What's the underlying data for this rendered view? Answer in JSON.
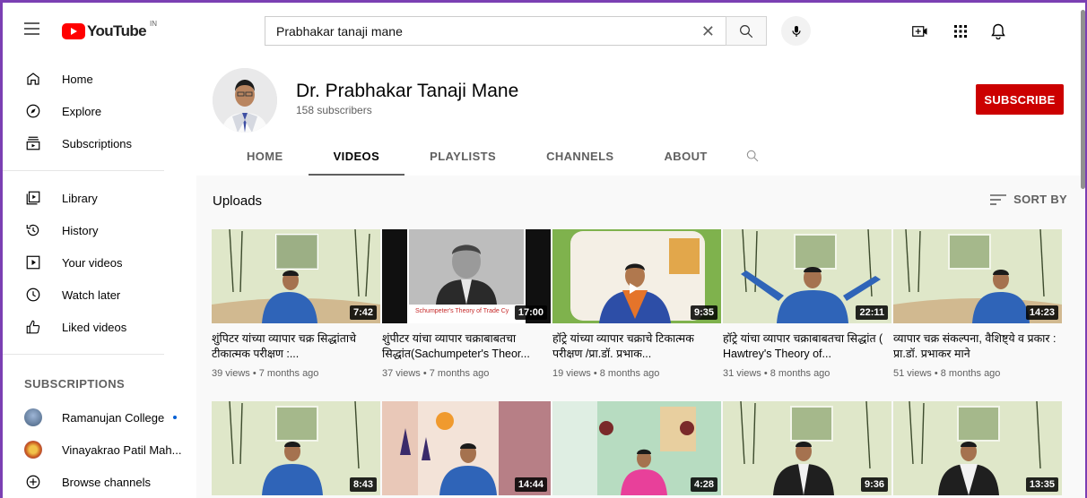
{
  "topbar": {
    "logo_text": "YouTube",
    "country_code": "IN",
    "search_value": "Prabhakar tanaji mane",
    "icons": [
      "menu-icon",
      "search-icon",
      "mic-icon",
      "create-icon",
      "apps-icon",
      "notifications-icon"
    ]
  },
  "sidebar": {
    "items": [
      {
        "label": "Home",
        "icon": "home-icon"
      },
      {
        "label": "Explore",
        "icon": "compass-icon"
      },
      {
        "label": "Subscriptions",
        "icon": "subscriptions-icon"
      },
      {
        "label": "Library",
        "icon": "library-icon"
      },
      {
        "label": "History",
        "icon": "history-icon"
      },
      {
        "label": "Your videos",
        "icon": "your-videos-icon"
      },
      {
        "label": "Watch later",
        "icon": "clock-icon"
      },
      {
        "label": "Liked videos",
        "icon": "thumbs-up-icon"
      }
    ],
    "subscriptions_heading": "SUBSCRIPTIONS",
    "subscriptions": [
      {
        "label": "Ramanujan College"
      },
      {
        "label": "Vinayakrao Patil Mah..."
      }
    ],
    "browse_label": "Browse channels"
  },
  "channel": {
    "name": "Dr. Prabhakar Tanaji Mane",
    "subscribers": "158 subscribers",
    "subscribe_label": "SUBSCRIBE",
    "tabs": [
      "HOME",
      "VIDEOS",
      "PLAYLISTS",
      "CHANNELS",
      "ABOUT"
    ],
    "active_tab": "VIDEOS"
  },
  "uploads": {
    "heading": "Uploads",
    "sort_label": "SORT BY",
    "videos": [
      {
        "title": "शुंपिटर यांच्या व्यापार चक्र सिद्धांताचे टीकात्मक परीक्षण :...",
        "meta": "39 views • 7 months ago",
        "duration": "7:42"
      },
      {
        "title": "शुंपीटर यांचा व्यापार चक्राबाबतचा सिद्धांत(Sachumpeter's Theor...",
        "meta": "37 views • 7 months ago",
        "duration": "17:00",
        "thumb_caption": "Schumpeter's Theory of Trade Cy"
      },
      {
        "title": "हॉट्रे यांच्या व्यापार चक्राचे टिकात्मक परीक्षण /प्रा.डॉ. प्रभाक...",
        "meta": "19 views • 8 months ago",
        "duration": "9:35"
      },
      {
        "title": "हॉट्रे यांचा व्यापार चक्राबाबतचा सिद्धांत ( Hawtrey's Theory of...",
        "meta": "31 views • 8 months ago",
        "duration": "22:11"
      },
      {
        "title": "व्यापार चक्र संकल्पना, वैशिष्ट्ये व प्रकार : प्रा.डॉ. प्रभाकर माने",
        "meta": "51 views • 8 months ago",
        "duration": "14:23"
      },
      {
        "title": "",
        "meta": "",
        "duration": "8:43"
      },
      {
        "title": "",
        "meta": "",
        "duration": "14:44"
      },
      {
        "title": "",
        "meta": "",
        "duration": "4:28"
      },
      {
        "title": "",
        "meta": "",
        "duration": "9:36"
      },
      {
        "title": "",
        "meta": "",
        "duration": "13:35"
      }
    ]
  },
  "colors": {
    "subscribe": "#cc0000",
    "youtube_red": "#ff0000",
    "frame": "#7b3fb3"
  }
}
